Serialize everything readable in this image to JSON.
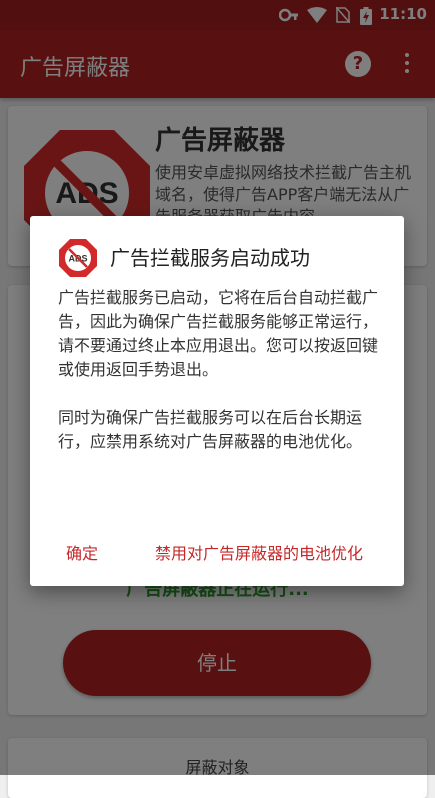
{
  "status_bar": {
    "time": "11:10"
  },
  "app_bar": {
    "title": "广告屏蔽器",
    "help_glyph": "?"
  },
  "header_card": {
    "logo_text": "ADS",
    "title": "广告屏蔽器",
    "description": "使用安卓虚拟网络技术拦截广告主机域名，使得广告APP客户端无法从广告服务器获取广告内容"
  },
  "control_card": {
    "status_text": "广告屏蔽器正在运行...",
    "stop_label": "停止"
  },
  "bottom_card": {
    "label": "屏蔽对象"
  },
  "dialog": {
    "logo_text": "ADS",
    "title": "广告拦截服务启动成功",
    "paragraph1": "广告拦截服务已启动，它将在后台自动拦截广告，因此为确保广告拦截服务能够正常运行，请不要通过终止本应用退出。您可以按返回键或使用返回手势退出。",
    "paragraph2": "同时为确保广告拦截服务可以在后台长期运行，应禁用系统对广告屏蔽器的电池优化。",
    "ok_label": "确定",
    "battery_label": "禁用对广告屏蔽器的电池优化"
  },
  "colors": {
    "primary": "#b32120",
    "status": "#a51f1f",
    "accent_text": "#c62828",
    "running": "#2e9b2e"
  }
}
